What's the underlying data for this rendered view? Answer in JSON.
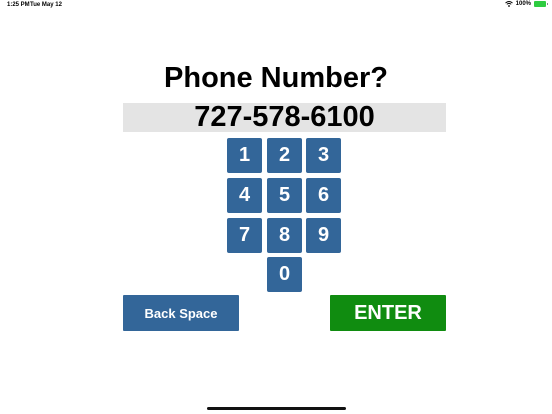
{
  "status_bar": {
    "time": "1:25 PM",
    "date": "Tue May 12",
    "battery_percent": "100%"
  },
  "title": "Phone Number?",
  "phone_value": "727-578-6100",
  "keypad": {
    "k1": "1",
    "k2": "2",
    "k3": "3",
    "k4": "4",
    "k5": "5",
    "k6": "6",
    "k7": "7",
    "k8": "8",
    "k9": "9",
    "k0": "0"
  },
  "buttons": {
    "backspace_label": "Back Space",
    "enter_label": "ENTER"
  },
  "colors": {
    "key_blue": "#336699",
    "enter_green": "#108c10",
    "display_gray": "#e4e4e4"
  },
  "icons": [
    "wifi-icon",
    "battery-icon"
  ]
}
